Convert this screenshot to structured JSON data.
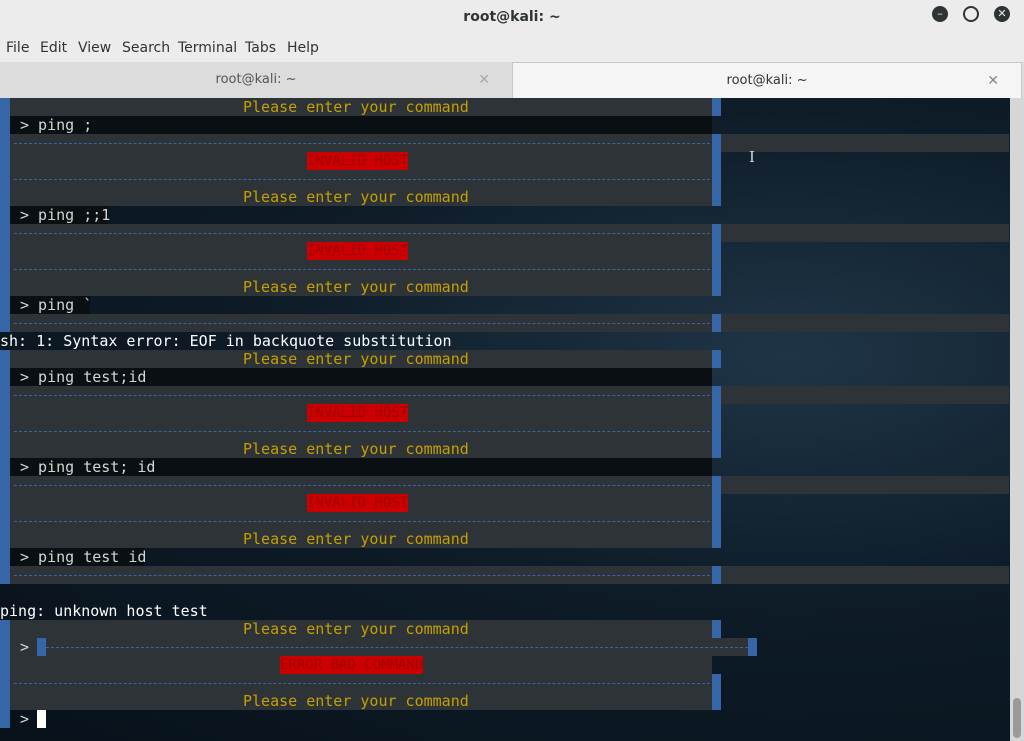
{
  "window": {
    "title": "root@kali: ~",
    "controls": [
      "minimize-icon",
      "maximize-icon",
      "close-icon"
    ]
  },
  "menu": [
    "File",
    "Edit",
    "View",
    "Search",
    "Terminal",
    "Tabs",
    "Help"
  ],
  "tabs": [
    {
      "label": "root@kali: ~",
      "active": false
    },
    {
      "label": "root@kali: ~",
      "active": true
    }
  ],
  "terminal": {
    "prompt_text": "Please enter your command",
    "invalid_host": "INVALID HOST",
    "error_bad": "ERROR BAD COMMAND",
    "prompt_marker": ">",
    "commands": [
      "> ping ;",
      "> ping ;;1",
      "> ping `",
      "> ping test;id",
      "> ping test; id",
      "> ping test id"
    ],
    "sh_error": "sh: 1: Syntax error: EOF in backquote substitution",
    "ping_error": "ping: unknown host test",
    "accent": "#3766a8",
    "prompt_color": "#c4a000",
    "error_bg": "#cc0000"
  }
}
